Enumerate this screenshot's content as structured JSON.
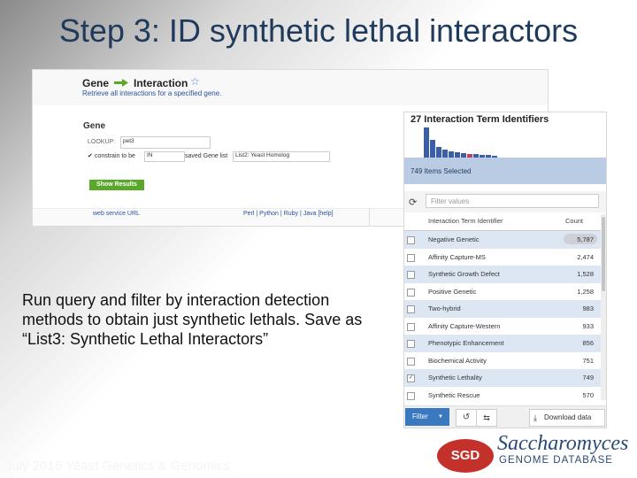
{
  "slide": {
    "title": "Step 3: ID synthetic lethal interactors",
    "body": "Run query and filter by interaction detection methods to obtain just synthetic lethals. Save as “List3: Synthetic Lethal Interactors”",
    "footer": "July 2016 Yeast Genetics & Genomics"
  },
  "query": {
    "from": "Gene",
    "to": "Interaction",
    "description": "Retrieve all interactions for a specified gene.",
    "section": "Gene",
    "lookup_label": "LOOKUP:",
    "lookup_value": "pet3",
    "constrain_label": "constrain to be",
    "constrain_op": "IN",
    "saved_label": "saved Gene list",
    "saved_list": "List2: Yeast Homolog",
    "button": "Show Results",
    "webservice": "web service URL",
    "languages": "Perl | Python | Ruby | Java [help]"
  },
  "facet": {
    "title": "27 Interaction Term Identifiers",
    "selected": "749 Items Selected",
    "filter_placeholder": "Filter values",
    "col_term": "Interaction Term Identifier",
    "col_count": "Count",
    "rows": [
      {
        "label": "Negative Genetic",
        "count": "5,787",
        "checked": false
      },
      {
        "label": "Affinity Capture-MS",
        "count": "2,474",
        "checked": false
      },
      {
        "label": "Synthetic Growth Defect",
        "count": "1,528",
        "checked": false
      },
      {
        "label": "Positive Genetic",
        "count": "1,258",
        "checked": false
      },
      {
        "label": "Two-hybrid",
        "count": "983",
        "checked": false
      },
      {
        "label": "Affinity Capture-Western",
        "count": "933",
        "checked": false
      },
      {
        "label": "Phenotypic Enhancement",
        "count": "856",
        "checked": false
      },
      {
        "label": "Biochemical Activity",
        "count": "751",
        "checked": false
      },
      {
        "label": "Synthetic Lethality",
        "count": "749",
        "checked": true
      },
      {
        "label": "Synthetic Rescue",
        "count": "570",
        "checked": false
      }
    ],
    "filter_button": "Filter",
    "download": "Download data"
  },
  "logo": {
    "mark": "SGD",
    "line1": "Saccharomyces",
    "line2": "GENOME DATABASE"
  },
  "colors": {
    "title": "#1f3a5a",
    "accent_blue": "#3a79c0",
    "selected_bar": "#b9cce4",
    "row_alt": "#dde7f4",
    "green_button": "#5aa82a",
    "logo_red": "#c4312a"
  }
}
